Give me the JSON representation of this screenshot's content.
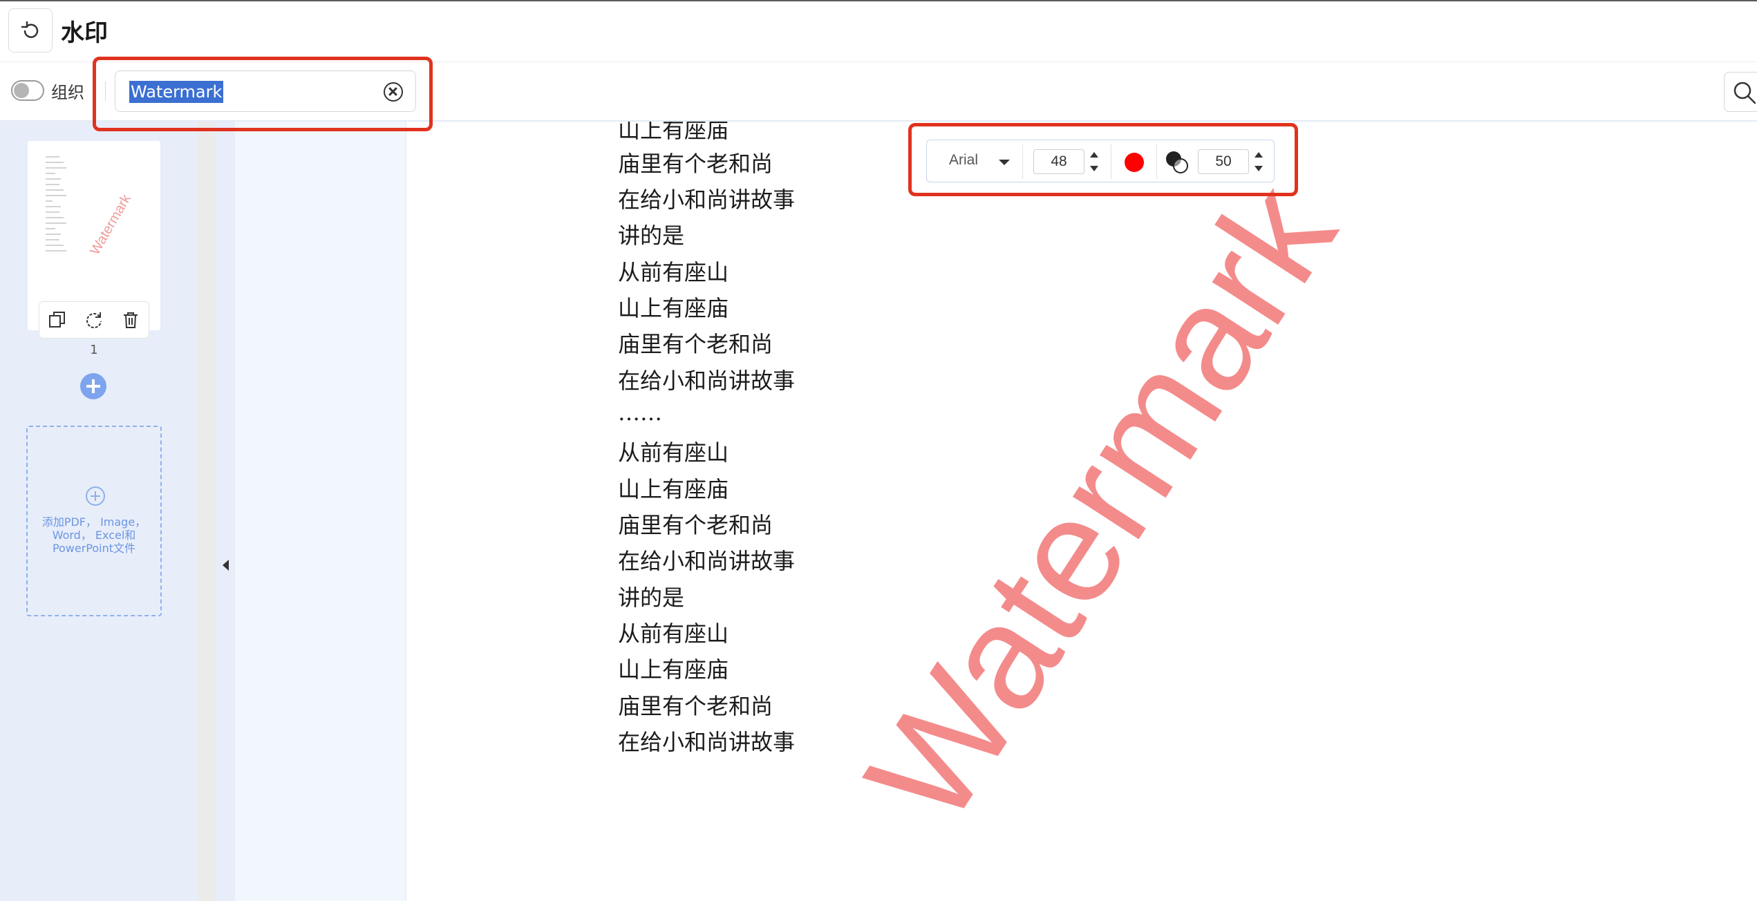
{
  "header": {
    "title": "水印"
  },
  "toolbar": {
    "organize_label": "组织",
    "watermark_text": "Watermark"
  },
  "sidebar": {
    "thumbnail_watermark": "Watermark",
    "page_number": "1",
    "dropzone_text": "添加PDF， Image，\nWord， Excel和\nPowerPoint文件"
  },
  "style_bar": {
    "font": "Arial",
    "font_size": "48",
    "color": "#ff0000",
    "opacity": "50"
  },
  "document": {
    "lines": [
      "山上有座庙",
      "庙里有个老和尚",
      "在给小和尚讲故事",
      "讲的是",
      "从前有座山",
      "山上有座庙",
      "庙里有个老和尚",
      "在给小和尚讲故事",
      "……",
      "从前有座山",
      "山上有座庙",
      "庙里有个老和尚",
      "在给小和尚讲故事",
      "讲的是",
      "从前有座山",
      "山上有座庙",
      "庙里有个老和尚",
      "在给小和尚讲故事"
    ],
    "watermark": "Watermark",
    "watermark_color": "#f48b8b"
  }
}
